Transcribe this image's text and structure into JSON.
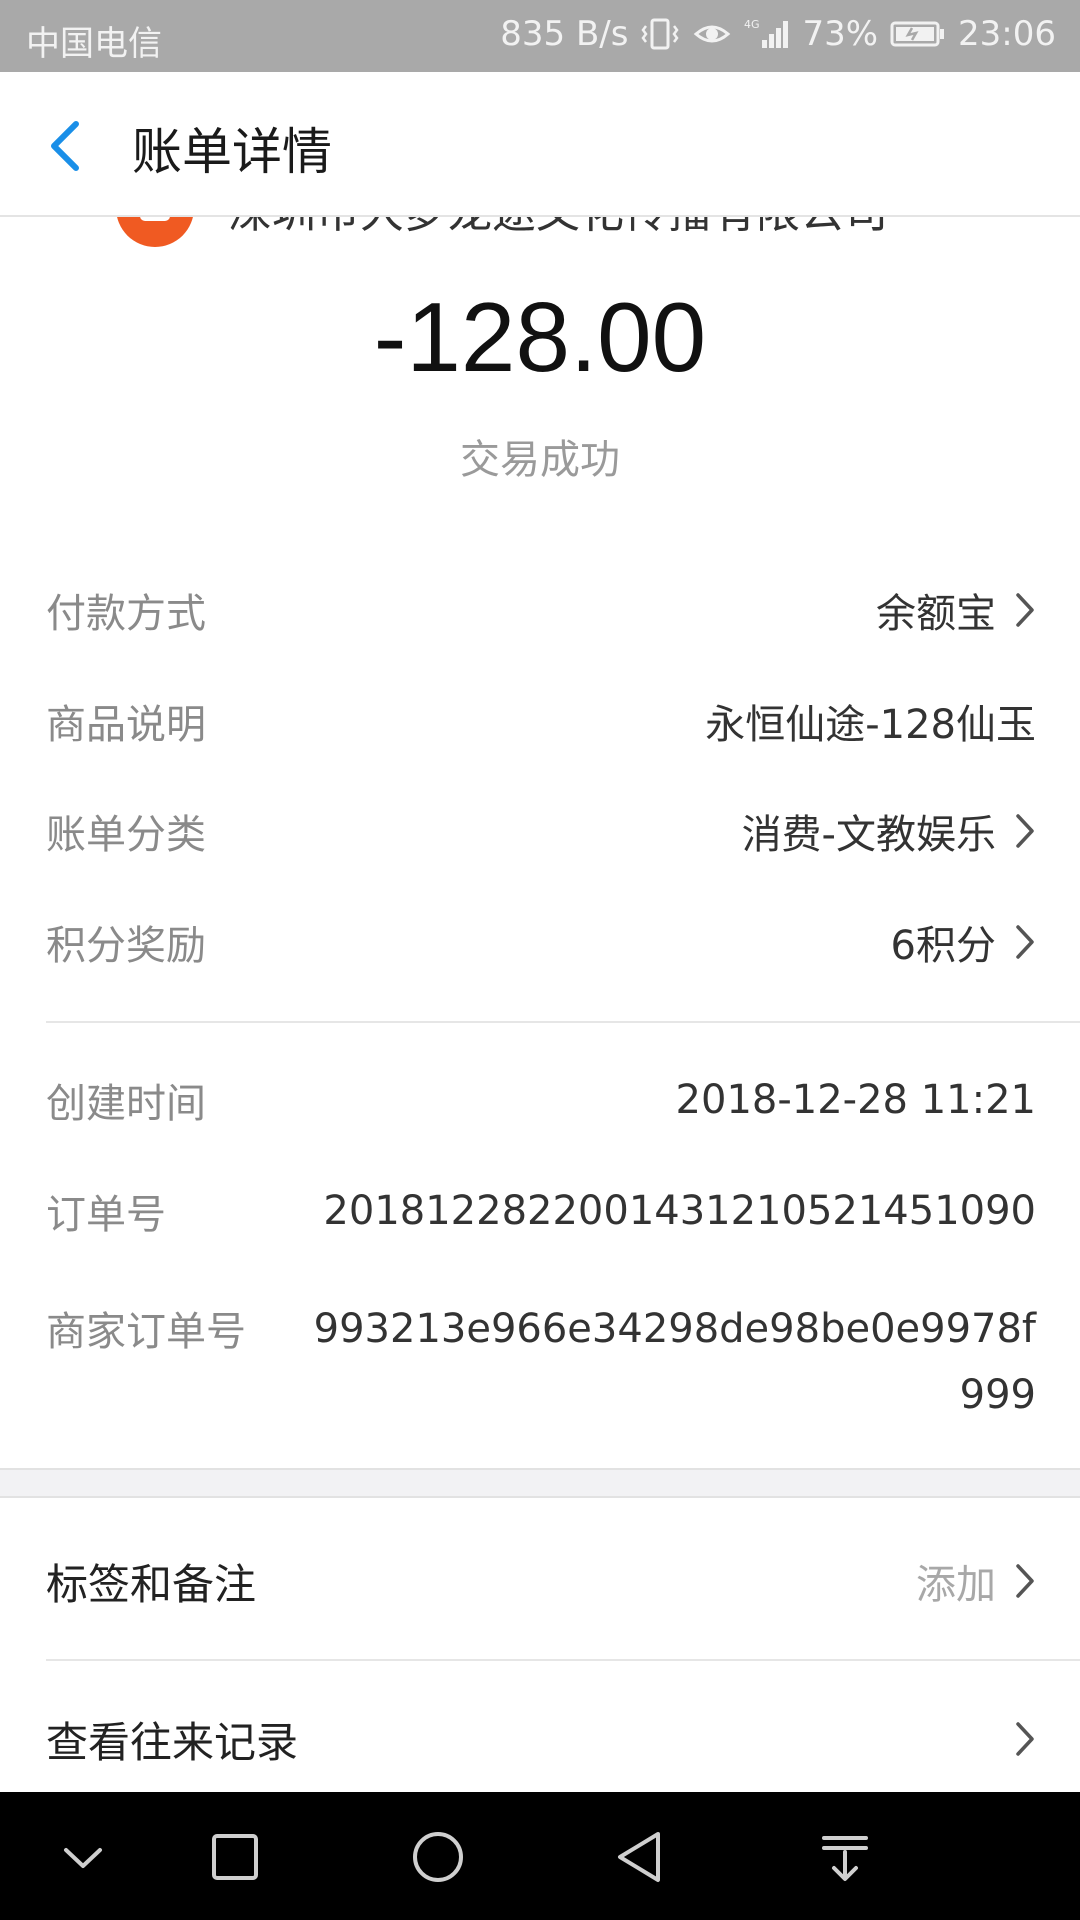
{
  "status_bar": {
    "carrier": "中国电信",
    "net_speed": "835 B/s",
    "network": "4G",
    "battery": "73%",
    "time": "23:06"
  },
  "header": {
    "title": "账单详情",
    "back_icon": "chevron-left-icon"
  },
  "merchant": {
    "name": "深圳市大梦龙途文化传播有限公司"
  },
  "transaction": {
    "amount": "-128.00",
    "status": "交易成功"
  },
  "details": [
    {
      "label": "付款方式",
      "value": "余额宝",
      "has_arrow": true
    },
    {
      "label": "商品说明",
      "value": "永恒仙途-128仙玉",
      "has_arrow": false
    },
    {
      "label": "账单分类",
      "value": "消费-文教娱乐",
      "has_arrow": true
    },
    {
      "label": "积分奖励",
      "value": "6积分",
      "has_arrow": true
    }
  ],
  "order_info": {
    "created_label": "创建时间",
    "created_value": "2018-12-28 11:21",
    "order_no_label": "订单号",
    "order_no_value": "2018122822001431210521451090",
    "merchant_order_label": "商家订单号",
    "merchant_order_value": "993213e966e34298de98be0e9978f999"
  },
  "actions": {
    "tags_label": "标签和备注",
    "tags_value": "添加",
    "history_label": "查看往来记录"
  },
  "colors": {
    "accent": "#1a8fe8",
    "merchant_logo": "#f05a22",
    "status_bar": "#a9a9a9"
  }
}
